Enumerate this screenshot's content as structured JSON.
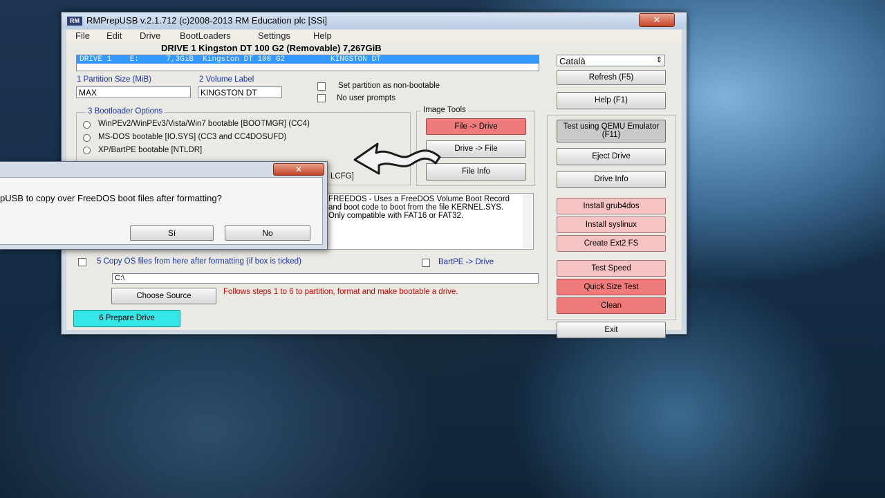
{
  "window": {
    "icon": "RM",
    "title": "RMPrepUSB v.2.1.712          (c)2008-2013 RM Education plc [SSi]",
    "close": "✕"
  },
  "menu": [
    "File",
    "Edit",
    "Drive",
    "BootLoaders",
    "Settings",
    "Help"
  ],
  "drive_header": "DRIVE 1 Kingston DT 100 G2  (Removable) 7,267GiB",
  "drive_list_row": "DRIVE 1    E:      7,3GiB  Kingston DT 100 G2          KINGSTON DT",
  "language": {
    "value": "Català",
    "arrows": "⇕"
  },
  "partition": {
    "label": "1 Partition Size (MiB)",
    "value": "MAX"
  },
  "volume": {
    "label": "2 Volume Label",
    "value": "KINGSTON DT"
  },
  "options": {
    "non_bootable": "Set partition as non-bootable",
    "no_prompts": "No user prompts"
  },
  "bootloader": {
    "group_label": "3 Bootloader Options",
    "items": [
      "WinPEv2/WinPEv3/Vista/Win7 bootable [BOOTMGR] (CC4)",
      "MS-DOS bootable [IO.SYS]    (CC3 and CC4DOSUFD)",
      "XP/BartPE bootable [NTLDR]"
    ],
    "partial_item": "LCFG]"
  },
  "image_tools": {
    "label": "Image Tools",
    "file_to_drive": "File -> Drive",
    "drive_to_file": "Drive -> File",
    "file_info": "File Info"
  },
  "description": "FREEDOS - Uses a FreeDOS Volume Boot Record and boot code to boot from the file KERNEL.SYS. Only compatible with FAT16 or FAT32.",
  "copy_os": {
    "label": "5 Copy OS files from here after formatting (if box is ticked)",
    "path": "C:\\"
  },
  "bartpe": "BartPE -> Drive",
  "choose_source": "Choose Source",
  "follow_steps": "Follows steps 1 to 6 to partition, format and make bootable a drive.",
  "prepare_drive": "6 Prepare Drive",
  "right_buttons": {
    "refresh": "Refresh (F5)",
    "help": "Help (F1)",
    "qemu": "Test using QEMU Emulator (F11)",
    "eject": "Eject Drive",
    "drive_info": "Drive Info",
    "grub4dos": "Install grub4dos",
    "syslinux": "Install syslinux",
    "ext2": "Create Ext2 FS",
    "test_speed": "Test Speed",
    "quick_size": "Quick Size Test",
    "clean": "Clean",
    "exit": "Exit"
  },
  "dialog": {
    "close": "✕",
    "message": "pUSB to copy over FreeDOS boot files after formatting?",
    "yes": "Sí",
    "no": "No"
  },
  "colors": {
    "red_button": "#f07b7b",
    "pink_button": "#f6c3c3",
    "cyan_button": "#35e6e6",
    "highlight": "#3399ff"
  }
}
